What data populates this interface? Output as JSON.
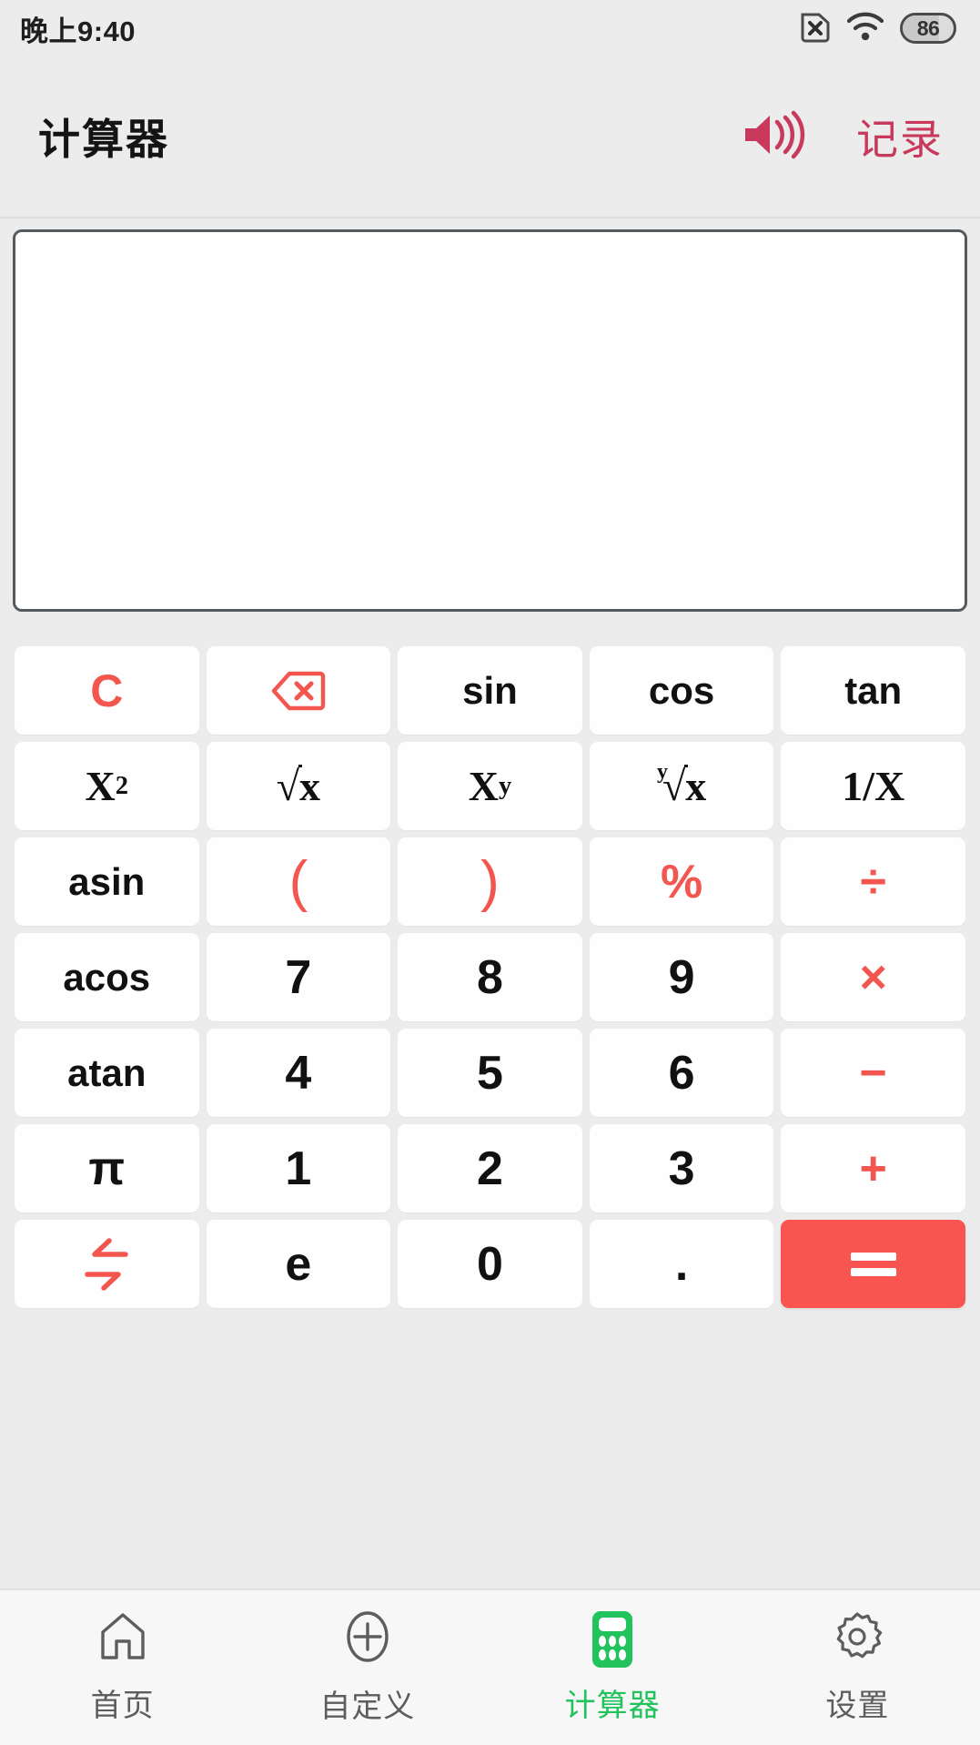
{
  "status_bar": {
    "time": "晚上9:40",
    "sim_icon": "no-sim-icon",
    "wifi_icon": "wifi-icon",
    "battery_level": "86"
  },
  "header": {
    "title": "计算器",
    "sound_icon": "speaker-icon",
    "history_label": "记录",
    "accent_color": "#c8395c"
  },
  "display": {
    "value": "",
    "placeholder": ""
  },
  "keypad": {
    "accent_color": "#f2564f",
    "equals_bg": "#f9544f",
    "rows": [
      [
        {
          "name": "key-clear",
          "label": "C",
          "kind": "clear"
        },
        {
          "name": "key-backspace",
          "label": "",
          "kind": "icon-backspace"
        },
        {
          "name": "key-sin",
          "label": "sin",
          "kind": "fn"
        },
        {
          "name": "key-cos",
          "label": "cos",
          "kind": "fn"
        },
        {
          "name": "key-tan",
          "label": "tan",
          "kind": "fn"
        }
      ],
      [
        {
          "name": "key-x-squared",
          "label": "X",
          "sup": "2",
          "kind": "math"
        },
        {
          "name": "key-sqrt-x",
          "label": "x",
          "index": "",
          "kind": "radical"
        },
        {
          "name": "key-x-pow-y",
          "label": "X",
          "sup": "y",
          "kind": "math"
        },
        {
          "name": "key-nth-root-x",
          "label": "x",
          "index": "y",
          "kind": "radical"
        },
        {
          "name": "key-reciprocal",
          "label": "1/X",
          "kind": "math"
        }
      ],
      [
        {
          "name": "key-asin",
          "label": "asin",
          "kind": "fn"
        },
        {
          "name": "key-paren-open",
          "label": "(",
          "kind": "paren"
        },
        {
          "name": "key-paren-close",
          "label": ")",
          "kind": "paren"
        },
        {
          "name": "key-percent",
          "label": "%",
          "kind": "op"
        },
        {
          "name": "key-divide",
          "label": "÷",
          "kind": "op"
        }
      ],
      [
        {
          "name": "key-acos",
          "label": "acos",
          "kind": "fn"
        },
        {
          "name": "key-7",
          "label": "7",
          "kind": "num"
        },
        {
          "name": "key-8",
          "label": "8",
          "kind": "num"
        },
        {
          "name": "key-9",
          "label": "9",
          "kind": "num"
        },
        {
          "name": "key-multiply",
          "label": "×",
          "kind": "op"
        }
      ],
      [
        {
          "name": "key-atan",
          "label": "atan",
          "kind": "fn"
        },
        {
          "name": "key-4",
          "label": "4",
          "kind": "num"
        },
        {
          "name": "key-5",
          "label": "5",
          "kind": "num"
        },
        {
          "name": "key-6",
          "label": "6",
          "kind": "num"
        },
        {
          "name": "key-minus",
          "label": "−",
          "kind": "op"
        }
      ],
      [
        {
          "name": "key-pi",
          "label": "π",
          "kind": "num"
        },
        {
          "name": "key-1",
          "label": "1",
          "kind": "num"
        },
        {
          "name": "key-2",
          "label": "2",
          "kind": "num"
        },
        {
          "name": "key-3",
          "label": "3",
          "kind": "num"
        },
        {
          "name": "key-plus",
          "label": "+",
          "kind": "op"
        }
      ],
      [
        {
          "name": "key-swap",
          "label": "",
          "kind": "icon-swap"
        },
        {
          "name": "key-e",
          "label": "e",
          "kind": "num"
        },
        {
          "name": "key-0",
          "label": "0",
          "kind": "num"
        },
        {
          "name": "key-decimal",
          "label": ".",
          "kind": "num"
        },
        {
          "name": "key-equals",
          "label": "",
          "kind": "equals"
        }
      ]
    ]
  },
  "bottom_nav": {
    "active_color": "#22c25c",
    "items": [
      {
        "name": "nav-item-home",
        "label": "首页",
        "icon": "home-icon",
        "active": false
      },
      {
        "name": "nav-item-custom",
        "label": "自定义",
        "icon": "plus-circle-icon",
        "active": false
      },
      {
        "name": "nav-item-calculator",
        "label": "计算器",
        "icon": "calculator-icon",
        "active": true
      },
      {
        "name": "nav-item-settings",
        "label": "设置",
        "icon": "gear-icon",
        "active": false
      }
    ]
  }
}
